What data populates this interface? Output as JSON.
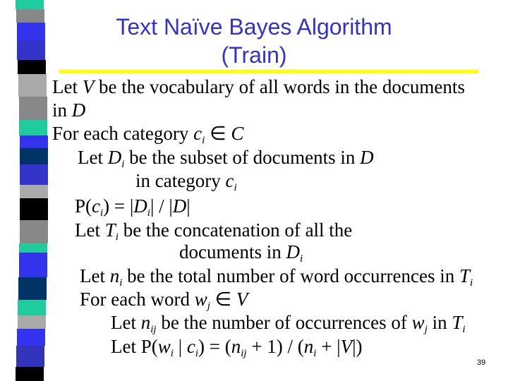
{
  "slide": {
    "title_line1": "Text Naïve Bayes Algorithm",
    "title_line2": "(Train)",
    "title_color": "#3333cc",
    "rule_color": "#ffff00",
    "page_number": "39",
    "lines": [
      {
        "html": "Let <i>V</i> be the vocabulary of all words in the documents"
      },
      {
        "html": "in <i>D</i>"
      },
      {
        "html": "For each category <i>c<sub>i</sub></i> &isin; <i>C</i>"
      },
      {
        "html": "Let <i>D<sub>i</sub></i> be the subset of documents in <i>D</i>"
      },
      {
        "html": "in category <i>c<sub>i</sub></i>"
      },
      {
        "html": "P(<i>c<sub>i</sub></i>) = |<i>D<sub>i</sub></i>| / |<i>D</i>|"
      },
      {
        "html": "Let <i>T<sub>i</sub></i> be the concatenation of all the"
      },
      {
        "html": "documents in <i>D<sub>i</sub></i>"
      },
      {
        "html": "Let <i>n<sub>i</sub></i> be the total number of word occurrences in <i>T<sub>i</sub></i>"
      },
      {
        "html": "For each word <i>w<sub>j</sub></i> &isin; <i>V</i>"
      },
      {
        "html": "Let <i>n<sub>ij</sub></i> be the number of occurrences of <i>w<sub>j</sub></i> in <i>T<sub>i</sub></i>"
      },
      {
        "html": "Let P(<i>w<sub>i</sub></i> | <i>c<sub>i</sub></i>) = (<i>n<sub>ij</sub></i> + 1) / (<i>n<sub>i</sub></i> + |<i>V</i>|)"
      }
    ]
  },
  "sidebar": {
    "segment_colors": [
      "#1fcc9e",
      "#888888",
      "#3333ee",
      "#3333cc",
      "#000000",
      "#aaaaaa",
      "#888888",
      "#1fcc9e",
      "#3333ee",
      "#003366",
      "#3333cc",
      "#aaaaaa",
      "#000000",
      "#888888",
      "#1fcc9e",
      "#3333ee",
      "#003366",
      "#1fcc9e",
      "#aaaaaa",
      "#3333ee",
      "#3333bb",
      "#000000"
    ]
  }
}
